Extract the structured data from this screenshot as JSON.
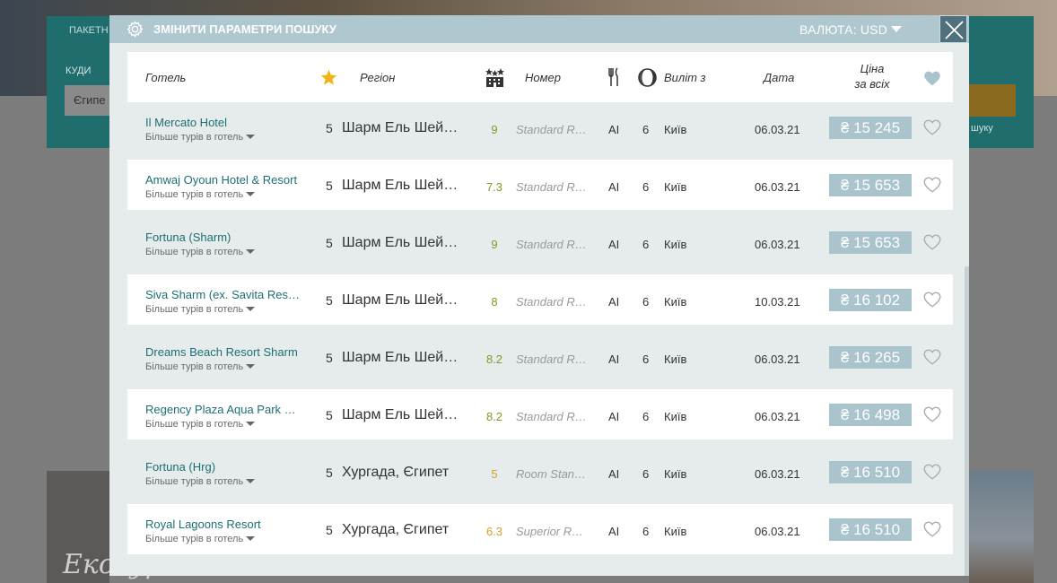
{
  "background": {
    "tab_label": "ПАКЕТН",
    "where_label": "КУДИ",
    "where_value": "Єгипе",
    "more_label": "шуку",
    "promo_text": "Екскурсійні"
  },
  "modal": {
    "title": "ЗМІНИТИ ПАРАМЕТРИ ПОШУКУ",
    "currency": "ВАЛЮТА: USD",
    "columns": {
      "hotel": "Готель",
      "region": "Регіон",
      "room": "Номер",
      "departure": "Виліт з",
      "date": "Дата",
      "price_line1": "Ціна",
      "price_line2": "за всіх"
    },
    "more_tours_label": "Більше турів в готель",
    "rows": [
      {
        "hotel": "Il Mercato Hotel",
        "stars": "5",
        "region": "Шарм Ель Шейх, Єгипет",
        "rating": "9",
        "room": "Standard Room",
        "meal": "AI",
        "nights": "6",
        "city": "Київ",
        "date": "06.03.21",
        "price": "₴ 15 245"
      },
      {
        "hotel": "Amwaj Oyoun Hotel & Resort",
        "stars": "5",
        "region": "Шарм Ель Шейх, Єгипет",
        "rating": "7.3",
        "room": "Standard Room",
        "meal": "AI",
        "nights": "6",
        "city": "Київ",
        "date": "06.03.21",
        "price": "₴ 15 653"
      },
      {
        "hotel": "Fortuna (Sharm)",
        "stars": "5",
        "region": "Шарм Ель Шейх, Єгипет",
        "rating": "9",
        "room": "Standard Room",
        "meal": "AI",
        "nights": "6",
        "city": "Київ",
        "date": "06.03.21",
        "price": "₴ 15 653"
      },
      {
        "hotel": "Siva Sharm (ex. Savita Resort)",
        "stars": "5",
        "region": "Шарм Ель Шейх, Єгипет",
        "rating": "8",
        "room": "Standard Room",
        "meal": "AI",
        "nights": "6",
        "city": "Київ",
        "date": "10.03.21",
        "price": "₴ 16 102"
      },
      {
        "hotel": "Dreams Beach Resort Sharm",
        "stars": "5",
        "region": "Шарм Ель Шейх, Єгипет",
        "rating": "8.2",
        "room": "Standard Room",
        "meal": "AI",
        "nights": "6",
        "city": "Київ",
        "date": "06.03.21",
        "price": "₴ 16 265"
      },
      {
        "hotel": "Regency Plaza Aqua Park & Spa",
        "stars": "5",
        "region": "Шарм Ель Шейх, Єгипет",
        "rating": "8.2",
        "room": "Standard Room",
        "meal": "AI",
        "nights": "6",
        "city": "Київ",
        "date": "06.03.21",
        "price": "₴ 16 498"
      },
      {
        "hotel": "Fortuna (Hrg)",
        "stars": "5",
        "region": "Хургада, Єгипет",
        "rating": "5",
        "room": "Room Standard",
        "meal": "AI",
        "nights": "6",
        "city": "Київ",
        "date": "06.03.21",
        "price": "₴ 16 510"
      },
      {
        "hotel": "Royal Lagoons Resort",
        "stars": "5",
        "region": "Хургада, Єгипет",
        "rating": "6.3",
        "room": "Superior Room",
        "meal": "AI",
        "nights": "6",
        "city": "Київ",
        "date": "06.03.21",
        "price": "₴ 16 510"
      }
    ]
  },
  "colors": {
    "hotel_link": "#1d6f72",
    "rating_high": "#7f9a25",
    "rating_low": "#d5a02b",
    "price_badge": "#a9c4cd",
    "header_bar": "#afc7cf",
    "star": "#f1b416"
  },
  "icons": {
    "settings": "gear-icon",
    "close": "close-icon",
    "star": "star-icon",
    "rating": "building-stars-icon",
    "meal": "fork-knife-icon",
    "nights": "moon-icon",
    "favorite": "heart-icon"
  }
}
